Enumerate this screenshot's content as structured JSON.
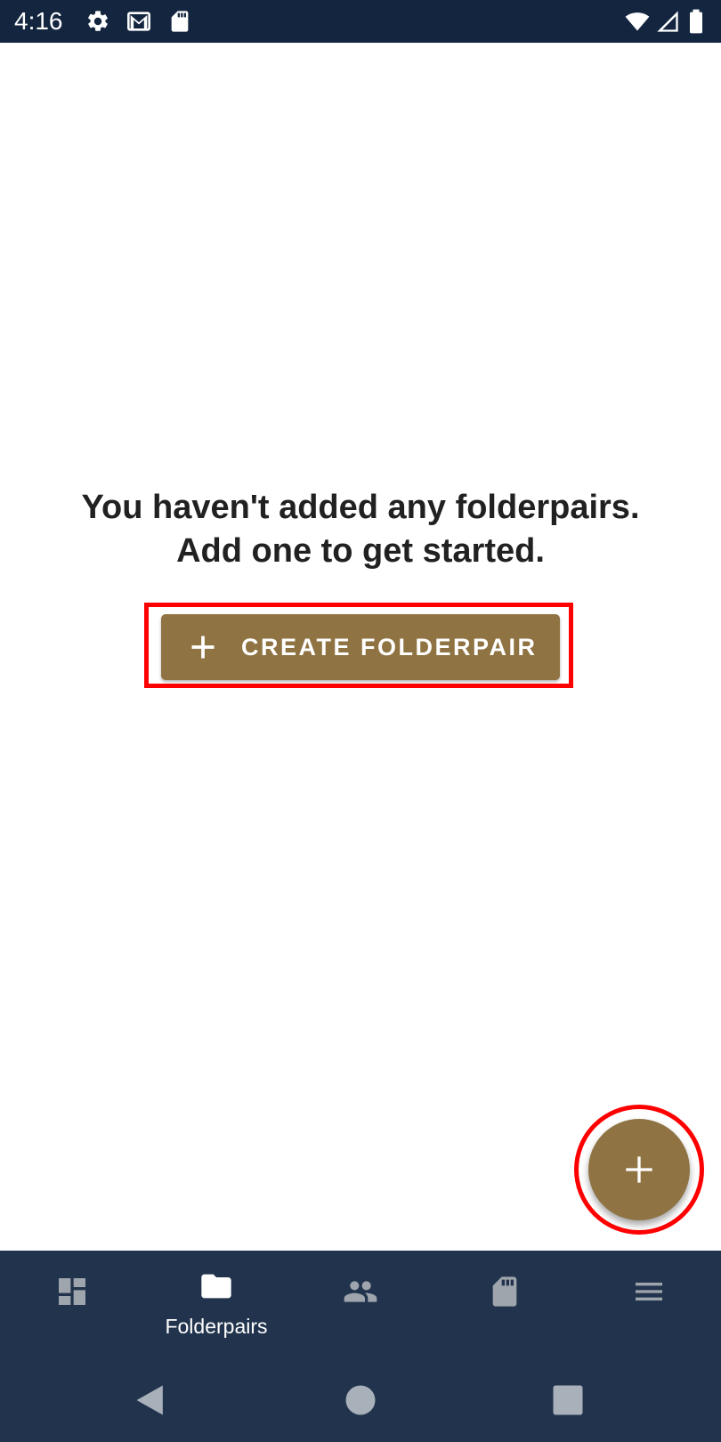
{
  "status_bar": {
    "time": "4:16",
    "icons_left": [
      "settings-icon",
      "gmail-icon",
      "sd-card-icon"
    ],
    "icons_right": [
      "wifi-icon",
      "signal-icon",
      "battery-icon"
    ]
  },
  "empty_state": {
    "line1": "You haven't added any folderpairs.",
    "line2": "Add one to get started.",
    "create_button_label": "CREATE FOLDERPAIR"
  },
  "bottom_nav": {
    "items": [
      {
        "icon": "dashboard-icon",
        "label": ""
      },
      {
        "icon": "folder-icon",
        "label": "Folderpairs",
        "active": true
      },
      {
        "icon": "accounts-icon",
        "label": ""
      },
      {
        "icon": "sd-card-icon",
        "label": ""
      },
      {
        "icon": "menu-icon",
        "label": ""
      }
    ]
  },
  "colors": {
    "accent": "#8f7342",
    "status_bar": "#13253f",
    "nav_bar": "#22344d",
    "inactive_icon": "#9ea5ad",
    "highlight": "#ff0000"
  }
}
